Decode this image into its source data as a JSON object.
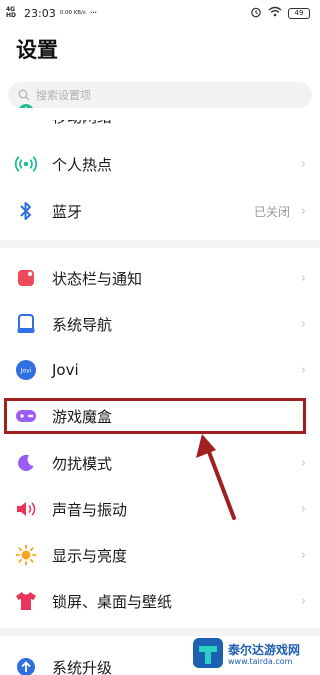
{
  "status_bar": {
    "network": "4G HD",
    "time": "23:03",
    "speed": "0.00 KB/s",
    "dots": "···",
    "battery": "49"
  },
  "title": "设置",
  "search": {
    "placeholder": "搜索设置项"
  },
  "items": [
    {
      "label": "移动网络",
      "value": ""
    },
    {
      "label": "个人热点",
      "value": ""
    },
    {
      "label": "蓝牙",
      "value": "已关闭"
    },
    {
      "label": "状态栏与通知",
      "value": ""
    },
    {
      "label": "系统导航",
      "value": ""
    },
    {
      "label": "Jovi",
      "value": ""
    },
    {
      "label": "游戏魔盒",
      "value": ""
    },
    {
      "label": "勿扰模式",
      "value": ""
    },
    {
      "label": "声音与振动",
      "value": ""
    },
    {
      "label": "显示与亮度",
      "value": ""
    },
    {
      "label": "锁屏、桌面与壁纸",
      "value": ""
    },
    {
      "label": "系统升级",
      "value": ""
    }
  ],
  "icons": {
    "mobile_network": "cellular-icon",
    "hotspot": "hotspot-icon",
    "bluetooth": "bluetooth-icon",
    "status_bar": "notification-icon",
    "navigation": "navigation-icon",
    "jovi": "jovi-icon",
    "game": "gamepad-icon",
    "dnd": "moon-icon",
    "sound": "speaker-icon",
    "display": "sun-icon",
    "wallpaper": "tshirt-icon",
    "upgrade": "upgrade-icon"
  },
  "chevron": "›",
  "jovi_badge": "Jovi",
  "watermark": {
    "name": "泰尔达游戏网",
    "url": "www.tairda.com"
  },
  "colors": {
    "highlight": "#a02020",
    "green": "#1fbf8f",
    "blue": "#2f6fe0",
    "red": "#f04a5a",
    "purple": "#9a5cf5",
    "orange": "#f5a623",
    "pink": "#e8365d"
  }
}
